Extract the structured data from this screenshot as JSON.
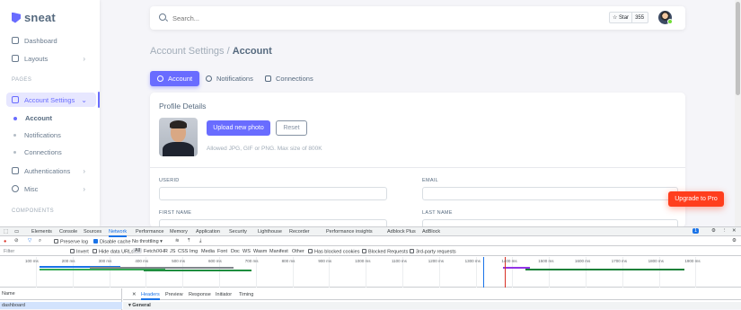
{
  "sidebar": {
    "logo": "sneat",
    "dashboard": "Dashboard",
    "layouts": "Layouts",
    "pages_header": "PAGES",
    "account_settings": "Account Settings",
    "sub": {
      "account": "Account",
      "notifications": "Notifications",
      "connections": "Connections"
    },
    "authentications": "Authentications",
    "misc": "Misc",
    "components_header": "COMPONENTS"
  },
  "navbar": {
    "search_placeholder": "Search...",
    "star_label": "Star",
    "star_count": "355"
  },
  "page": {
    "title_prefix": "Account Settings /",
    "title_current": "Account",
    "tabs": [
      "Account",
      "Notifications",
      "Connections"
    ]
  },
  "profile": {
    "title": "Profile Details",
    "upload_label": "Upload new photo",
    "reset_label": "Reset",
    "hint": "Allowed JPG, GIF or PNG. Max size of 800K",
    "fields": {
      "userid": "USERID",
      "email": "EMAIL",
      "first_name": "FIRST NAME",
      "last_name": "LAST NAME"
    }
  },
  "upgrade_label": "Upgrade to Pro",
  "devtools": {
    "tabs": [
      "Elements",
      "Console",
      "Sources",
      "Network",
      "Performance",
      "Memory",
      "Application",
      "Security",
      "Lighthouse",
      "Recorder",
      "Performance insights",
      "Adblock Plus",
      "AdBlock"
    ],
    "badge": "1",
    "toolbar": {
      "preserve_log": "Preserve log",
      "disable_cache": "Disable cache",
      "throttling": "No throttling"
    },
    "filter": {
      "placeholder": "Filter",
      "invert": "Invert",
      "hide_data_urls": "Hide data URLs",
      "types": [
        "All",
        "Fetch/XHR",
        "JS",
        "CSS",
        "Img",
        "Media",
        "Font",
        "Doc",
        "WS",
        "Wasm",
        "Manifest",
        "Other"
      ],
      "blocked_cookies": "Has blocked cookies",
      "blocked_requests": "Blocked Requests",
      "third_party": "3rd-party requests"
    },
    "timeline_ticks": [
      "100 ms",
      "200 ms",
      "300 ms",
      "400 ms",
      "500 ms",
      "600 ms",
      "700 ms",
      "800 ms",
      "900 ms",
      "1000 ms",
      "1100 ms",
      "1200 ms",
      "1300 ms",
      "1400 ms",
      "1500 ms",
      "1600 ms",
      "1700 ms",
      "1800 ms",
      "1900 ms"
    ],
    "name_header": "Name",
    "name_row": "dashboard",
    "detail_tabs": [
      "Headers",
      "Preview",
      "Response",
      "Initiator",
      "Timing"
    ],
    "general": "General"
  }
}
